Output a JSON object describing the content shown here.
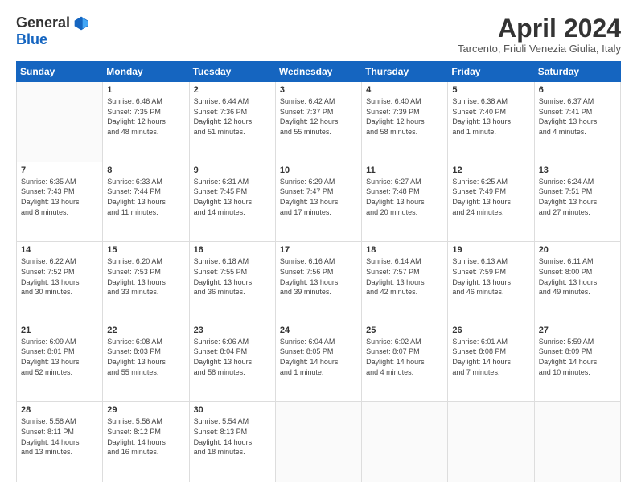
{
  "logo": {
    "general": "General",
    "blue": "Blue"
  },
  "title": "April 2024",
  "location": "Tarcento, Friuli Venezia Giulia, Italy",
  "days_of_week": [
    "Sunday",
    "Monday",
    "Tuesday",
    "Wednesday",
    "Thursday",
    "Friday",
    "Saturday"
  ],
  "weeks": [
    [
      {
        "day": "",
        "info": ""
      },
      {
        "day": "1",
        "info": "Sunrise: 6:46 AM\nSunset: 7:35 PM\nDaylight: 12 hours\nand 48 minutes."
      },
      {
        "day": "2",
        "info": "Sunrise: 6:44 AM\nSunset: 7:36 PM\nDaylight: 12 hours\nand 51 minutes."
      },
      {
        "day": "3",
        "info": "Sunrise: 6:42 AM\nSunset: 7:37 PM\nDaylight: 12 hours\nand 55 minutes."
      },
      {
        "day": "4",
        "info": "Sunrise: 6:40 AM\nSunset: 7:39 PM\nDaylight: 12 hours\nand 58 minutes."
      },
      {
        "day": "5",
        "info": "Sunrise: 6:38 AM\nSunset: 7:40 PM\nDaylight: 13 hours\nand 1 minute."
      },
      {
        "day": "6",
        "info": "Sunrise: 6:37 AM\nSunset: 7:41 PM\nDaylight: 13 hours\nand 4 minutes."
      }
    ],
    [
      {
        "day": "7",
        "info": "Sunrise: 6:35 AM\nSunset: 7:43 PM\nDaylight: 13 hours\nand 8 minutes."
      },
      {
        "day": "8",
        "info": "Sunrise: 6:33 AM\nSunset: 7:44 PM\nDaylight: 13 hours\nand 11 minutes."
      },
      {
        "day": "9",
        "info": "Sunrise: 6:31 AM\nSunset: 7:45 PM\nDaylight: 13 hours\nand 14 minutes."
      },
      {
        "day": "10",
        "info": "Sunrise: 6:29 AM\nSunset: 7:47 PM\nDaylight: 13 hours\nand 17 minutes."
      },
      {
        "day": "11",
        "info": "Sunrise: 6:27 AM\nSunset: 7:48 PM\nDaylight: 13 hours\nand 20 minutes."
      },
      {
        "day": "12",
        "info": "Sunrise: 6:25 AM\nSunset: 7:49 PM\nDaylight: 13 hours\nand 24 minutes."
      },
      {
        "day": "13",
        "info": "Sunrise: 6:24 AM\nSunset: 7:51 PM\nDaylight: 13 hours\nand 27 minutes."
      }
    ],
    [
      {
        "day": "14",
        "info": "Sunrise: 6:22 AM\nSunset: 7:52 PM\nDaylight: 13 hours\nand 30 minutes."
      },
      {
        "day": "15",
        "info": "Sunrise: 6:20 AM\nSunset: 7:53 PM\nDaylight: 13 hours\nand 33 minutes."
      },
      {
        "day": "16",
        "info": "Sunrise: 6:18 AM\nSunset: 7:55 PM\nDaylight: 13 hours\nand 36 minutes."
      },
      {
        "day": "17",
        "info": "Sunrise: 6:16 AM\nSunset: 7:56 PM\nDaylight: 13 hours\nand 39 minutes."
      },
      {
        "day": "18",
        "info": "Sunrise: 6:14 AM\nSunset: 7:57 PM\nDaylight: 13 hours\nand 42 minutes."
      },
      {
        "day": "19",
        "info": "Sunrise: 6:13 AM\nSunset: 7:59 PM\nDaylight: 13 hours\nand 46 minutes."
      },
      {
        "day": "20",
        "info": "Sunrise: 6:11 AM\nSunset: 8:00 PM\nDaylight: 13 hours\nand 49 minutes."
      }
    ],
    [
      {
        "day": "21",
        "info": "Sunrise: 6:09 AM\nSunset: 8:01 PM\nDaylight: 13 hours\nand 52 minutes."
      },
      {
        "day": "22",
        "info": "Sunrise: 6:08 AM\nSunset: 8:03 PM\nDaylight: 13 hours\nand 55 minutes."
      },
      {
        "day": "23",
        "info": "Sunrise: 6:06 AM\nSunset: 8:04 PM\nDaylight: 13 hours\nand 58 minutes."
      },
      {
        "day": "24",
        "info": "Sunrise: 6:04 AM\nSunset: 8:05 PM\nDaylight: 14 hours\nand 1 minute."
      },
      {
        "day": "25",
        "info": "Sunrise: 6:02 AM\nSunset: 8:07 PM\nDaylight: 14 hours\nand 4 minutes."
      },
      {
        "day": "26",
        "info": "Sunrise: 6:01 AM\nSunset: 8:08 PM\nDaylight: 14 hours\nand 7 minutes."
      },
      {
        "day": "27",
        "info": "Sunrise: 5:59 AM\nSunset: 8:09 PM\nDaylight: 14 hours\nand 10 minutes."
      }
    ],
    [
      {
        "day": "28",
        "info": "Sunrise: 5:58 AM\nSunset: 8:11 PM\nDaylight: 14 hours\nand 13 minutes."
      },
      {
        "day": "29",
        "info": "Sunrise: 5:56 AM\nSunset: 8:12 PM\nDaylight: 14 hours\nand 16 minutes."
      },
      {
        "day": "30",
        "info": "Sunrise: 5:54 AM\nSunset: 8:13 PM\nDaylight: 14 hours\nand 18 minutes."
      },
      {
        "day": "",
        "info": ""
      },
      {
        "day": "",
        "info": ""
      },
      {
        "day": "",
        "info": ""
      },
      {
        "day": "",
        "info": ""
      }
    ]
  ]
}
